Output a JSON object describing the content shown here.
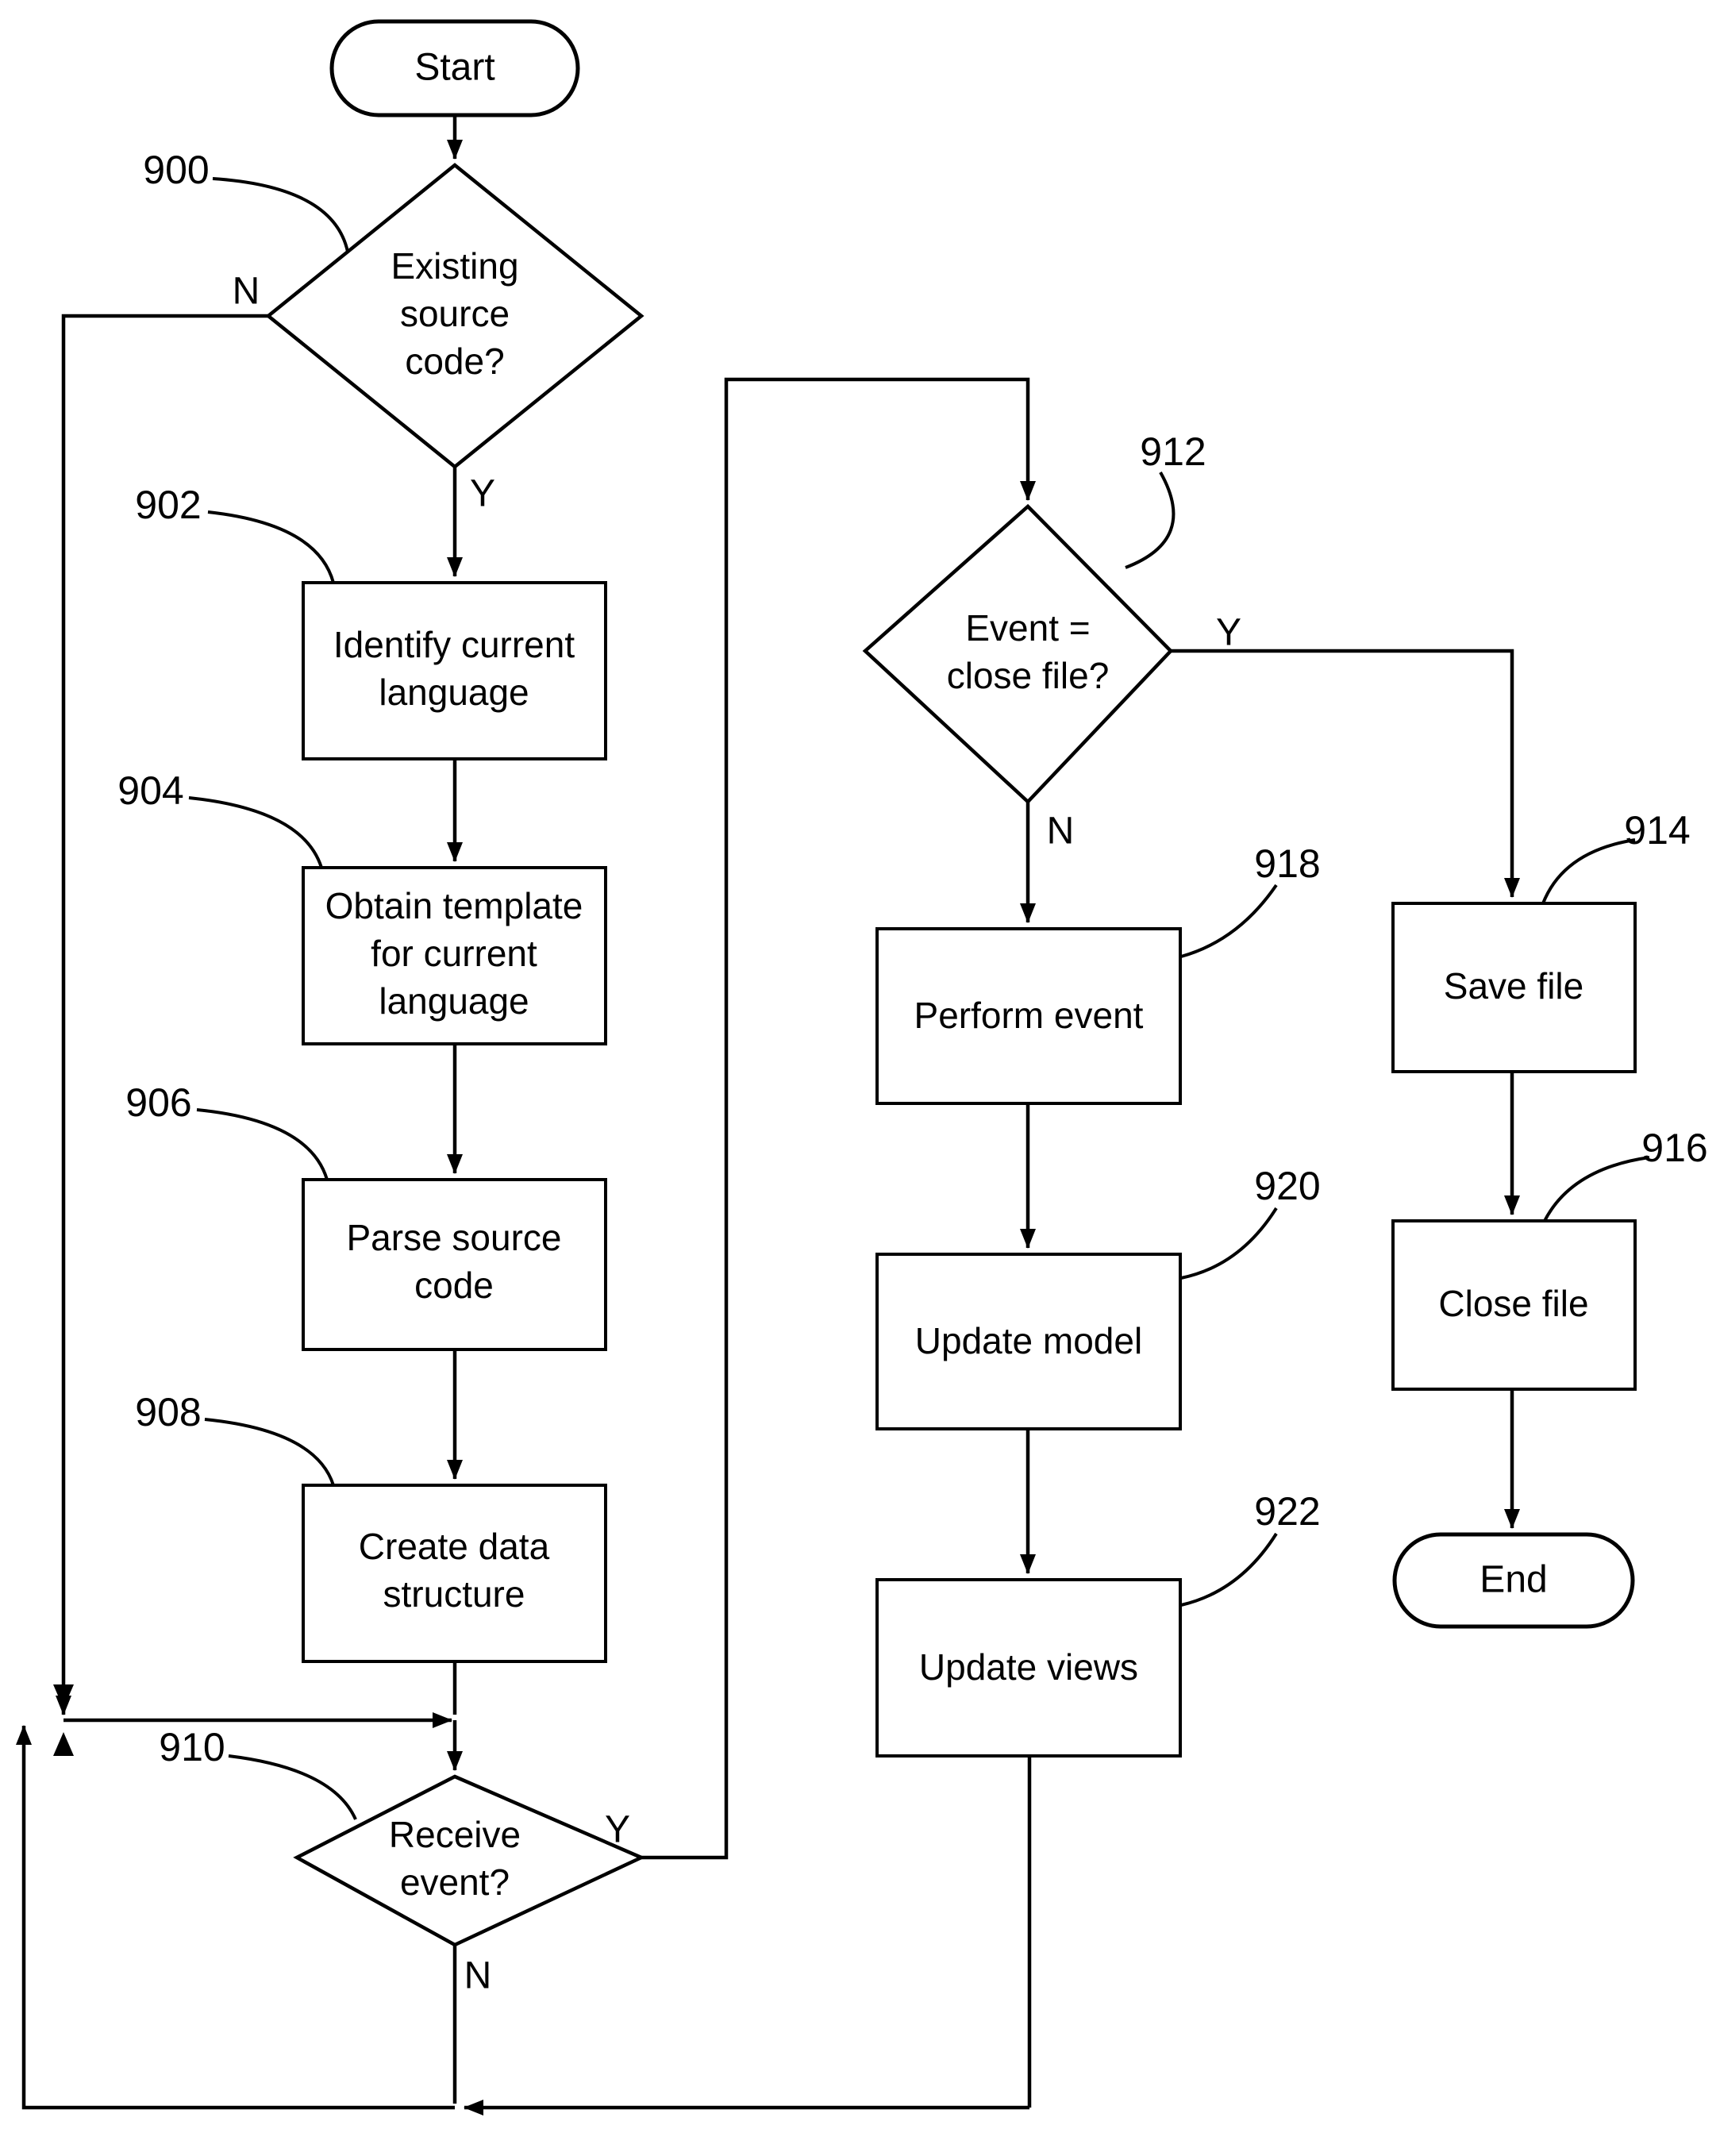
{
  "diagram": {
    "type": "flowchart",
    "title": "",
    "background_color": "#ffffff",
    "line_color": "#000000",
    "nodes": {
      "start": {
        "id": "start",
        "shape": "terminator",
        "label": "Start",
        "ref": ""
      },
      "existing_source": {
        "id": "900",
        "shape": "decision",
        "label_line1": "Existing",
        "label_line2": "source",
        "label_line3": "code?",
        "ref": "900"
      },
      "identify_language": {
        "id": "902",
        "shape": "process",
        "label_line1": "Identify current",
        "label_line2": "language",
        "ref": "902"
      },
      "obtain_template": {
        "id": "904",
        "shape": "process",
        "label_line1": "Obtain template",
        "label_line2": "for current",
        "label_line3": "language",
        "ref": "904"
      },
      "parse_source": {
        "id": "906",
        "shape": "process",
        "label_line1": "Parse source",
        "label_line2": "code",
        "ref": "906"
      },
      "create_structure": {
        "id": "908",
        "shape": "process",
        "label_line1": "Create data",
        "label_line2": "structure",
        "ref": "908"
      },
      "receive_event": {
        "id": "910",
        "shape": "decision",
        "label_line1": "Receive",
        "label_line2": "event?",
        "ref": "910"
      },
      "event_close_file": {
        "id": "912",
        "shape": "decision",
        "label_line1": "Event =",
        "label_line2": "close file?",
        "ref": "912"
      },
      "save_file": {
        "id": "914",
        "shape": "process",
        "label_line1": "Save file",
        "ref": "914"
      },
      "close_file": {
        "id": "916",
        "shape": "process",
        "label_line1": "Close file",
        "ref": "916"
      },
      "perform_event": {
        "id": "918",
        "shape": "process",
        "label_line1": "Perform event",
        "ref": "918"
      },
      "update_model": {
        "id": "920",
        "shape": "process",
        "label_line1": "Update model",
        "ref": "920"
      },
      "update_views": {
        "id": "922",
        "shape": "process",
        "label_line1": "Update views",
        "ref": "922"
      },
      "end": {
        "id": "end",
        "shape": "terminator",
        "label": "End",
        "ref": ""
      }
    },
    "branch_labels": {
      "existing_source_no": "N",
      "existing_source_yes": "Y",
      "receive_event_yes": "Y",
      "receive_event_no": "N",
      "event_close_yes": "Y",
      "event_close_no": "N"
    },
    "reference_numerals": {
      "n900": "900",
      "n902": "902",
      "n904": "904",
      "n906": "906",
      "n908": "908",
      "n910": "910",
      "n912": "912",
      "n914": "914",
      "n916": "916",
      "n918": "918",
      "n920": "920",
      "n922": "922"
    }
  }
}
